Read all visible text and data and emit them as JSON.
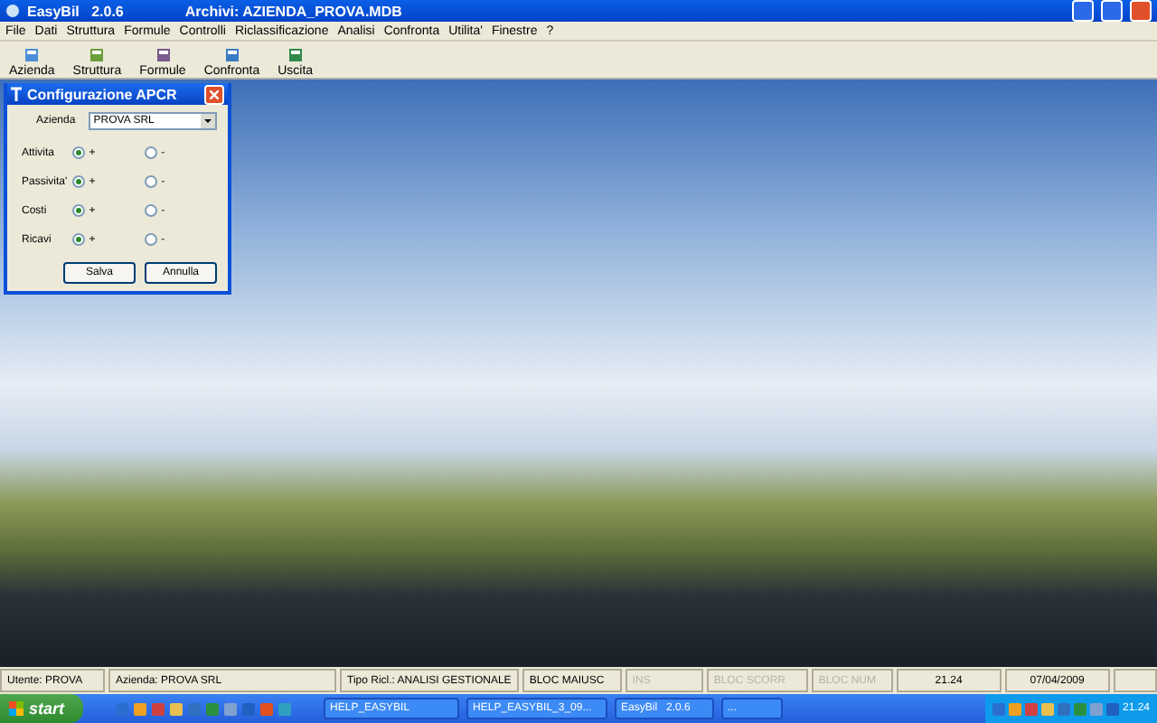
{
  "window": {
    "title": "EasyBil   2.0.6",
    "subtitle": "Archivi: AZIENDA_PROVA.MDB"
  },
  "menu": [
    "File",
    "Dati",
    "Struttura",
    "Formule",
    "Controlli",
    "Riclassificazione",
    "Analisi",
    "Confronta",
    "Utilita'",
    "Finestre",
    "?"
  ],
  "toolbar": [
    {
      "label": "Azienda",
      "kind": "company"
    },
    {
      "label": "Struttura",
      "kind": "structure"
    },
    {
      "label": "Formule",
      "kind": "formula"
    },
    {
      "label": "Confronta",
      "kind": "compare"
    },
    {
      "label": "Uscita",
      "kind": "exit"
    }
  ],
  "dialog": {
    "title": "Configurazione APCR",
    "company_label": "Azienda",
    "company_value": "PROVA SRL",
    "rows": [
      {
        "label": "Attivita",
        "options": [
          {
            "label": "+",
            "selected": true
          },
          {
            "label": "-",
            "selected": false
          }
        ]
      },
      {
        "label": "Passivita'",
        "options": [
          {
            "label": "+",
            "selected": true
          },
          {
            "label": "-",
            "selected": false
          }
        ]
      },
      {
        "label": "Costi",
        "options": [
          {
            "label": "+",
            "selected": true
          },
          {
            "label": "-",
            "selected": false
          }
        ]
      },
      {
        "label": "Ricavi",
        "options": [
          {
            "label": "+",
            "selected": true
          },
          {
            "label": "-",
            "selected": false
          }
        ]
      }
    ],
    "buttons": [
      "Salva",
      "Annulla"
    ]
  },
  "status_bar": [
    {
      "text": "Utente: PROVA",
      "disabled": false
    },
    {
      "text": "Azienda: PROVA SRL",
      "disabled": false
    },
    {
      "text": "Tipo Ricl.: ANALISI GESTIONALE",
      "disabled": false
    },
    {
      "text": "BLOC MAIUSC",
      "disabled": false
    },
    {
      "text": "INS",
      "disabled": true
    },
    {
      "text": "BLOC SCORR",
      "disabled": true
    },
    {
      "text": "BLOC NUM",
      "disabled": true
    },
    {
      "text": "21.24",
      "disabled": false
    },
    {
      "text": "07/04/2009",
      "disabled": false
    }
  ],
  "taskbar": {
    "start": "start",
    "tasks": [
      "HELP_EASYBIL",
      "HELP_EASYBIL_3_09...",
      "EasyBil   2.0.6",
      "..."
    ],
    "clock": "21.24"
  }
}
